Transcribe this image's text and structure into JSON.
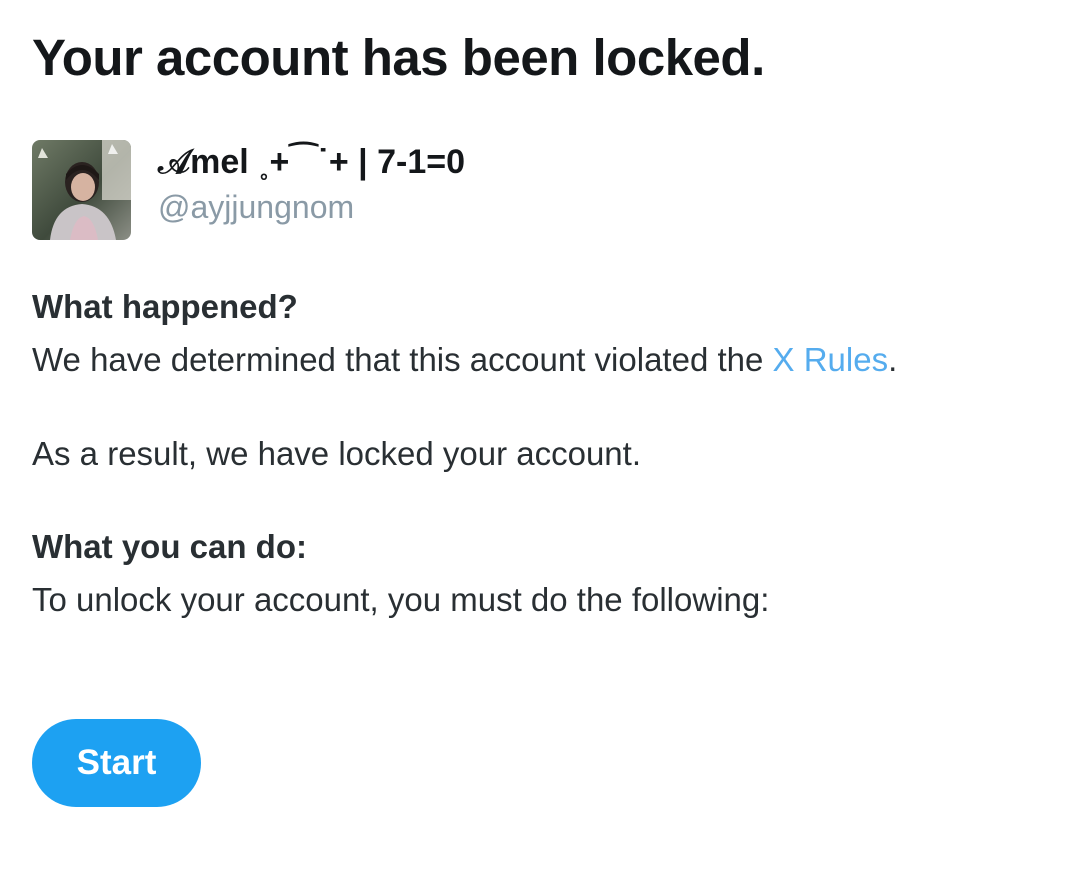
{
  "page": {
    "title": "Your account has been locked."
  },
  "profile": {
    "display_name": "𝒜mel ˳+⁀˙+ | 7-1=0",
    "handle": "@ayjjungnom",
    "avatar_icon": "profile-photo"
  },
  "what_happened": {
    "heading": "What happened?",
    "text_before_link": "We have determined that this account violated the ",
    "link_label": "X Rules",
    "text_after_link": ".",
    "result_text": "As a result, we have locked your account."
  },
  "what_you_can_do": {
    "heading": "What you can do:",
    "text": "To unlock your account, you must do the following:"
  },
  "actions": {
    "start_label": "Start"
  },
  "colors": {
    "link": "#55acee",
    "button": "#1da1f2",
    "handle": "#8a9aa6",
    "text": "#292f33"
  }
}
